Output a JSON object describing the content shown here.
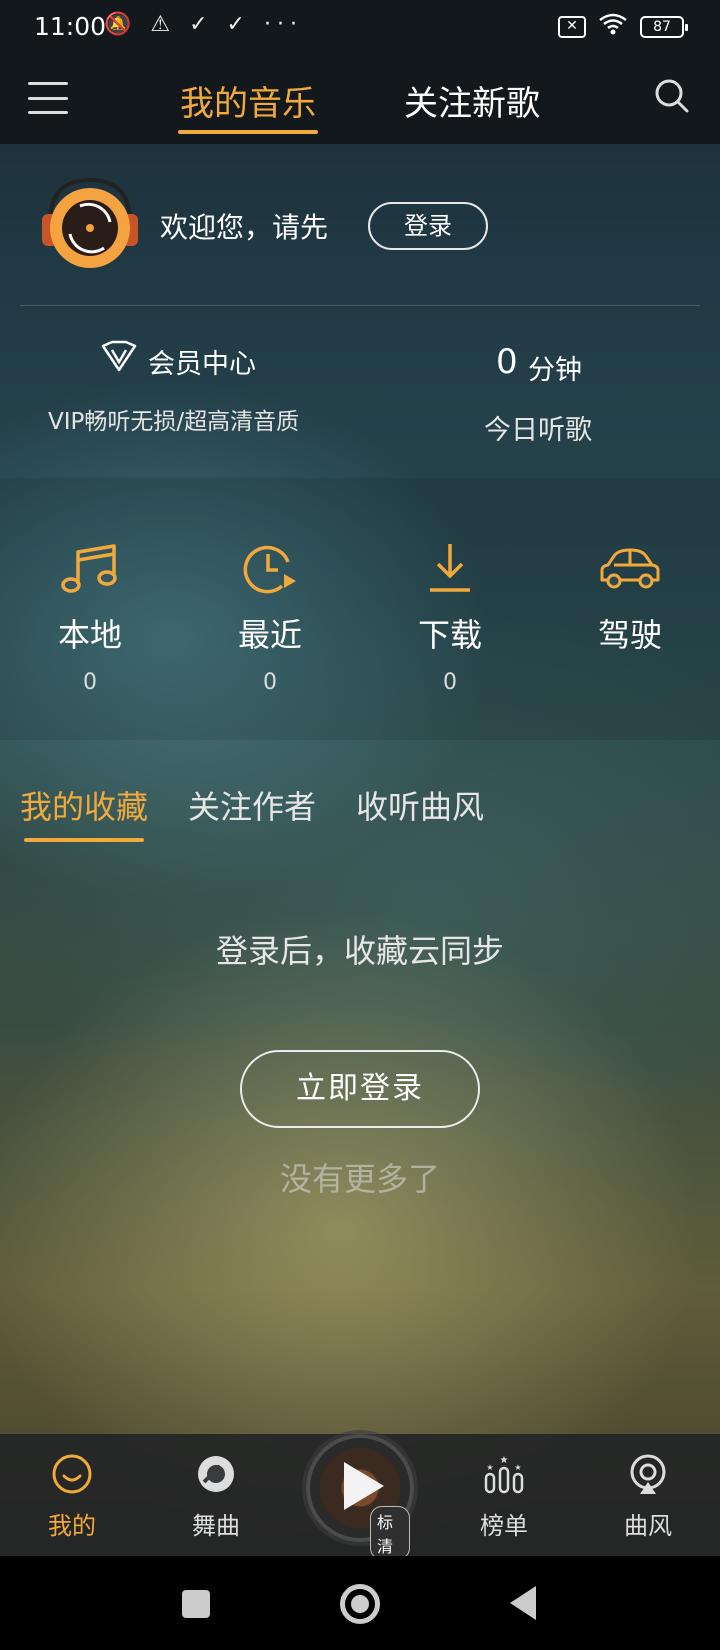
{
  "status_bar": {
    "time": "11:00",
    "left_icons": "🔕 ⚠ ✓ ✓ ···",
    "battery": "87"
  },
  "top_nav": {
    "tabs": [
      {
        "label": "我的音乐",
        "active": true
      },
      {
        "label": "关注新歌",
        "active": false
      }
    ]
  },
  "profile": {
    "welcome": "欢迎您，请先",
    "login_label": "登录"
  },
  "vip": {
    "title": "会员中心",
    "subtitle": "VIP畅听无损/超高清音质"
  },
  "today": {
    "minutes": "0",
    "unit": "分钟",
    "label": "今日听歌"
  },
  "quick_actions": [
    {
      "label": "本地",
      "count": "0",
      "icon": "music-note-icon"
    },
    {
      "label": "最近",
      "count": "0",
      "icon": "recent-clock-icon"
    },
    {
      "label": "下载",
      "count": "0",
      "icon": "download-icon"
    },
    {
      "label": "驾驶",
      "count": "",
      "icon": "car-icon"
    }
  ],
  "sub_tabs": [
    {
      "label": "我的收藏",
      "active": true
    },
    {
      "label": "关注作者",
      "active": false
    },
    {
      "label": "收听曲风",
      "active": false
    }
  ],
  "empty_state": {
    "message": "登录后，收藏云同步",
    "button": "立即登录",
    "no_more": "没有更多了"
  },
  "bottom_nav": {
    "items": [
      {
        "label": "我的",
        "icon": "smile-icon",
        "active": true
      },
      {
        "label": "舞曲",
        "icon": "disc-icon",
        "active": false
      },
      {
        "label": "榜单",
        "icon": "ranking-icon",
        "active": false
      },
      {
        "label": "曲风",
        "icon": "broadcast-icon",
        "active": false
      }
    ],
    "player_quality": "标清"
  },
  "colors": {
    "accent": "#f2a93b",
    "top_bar": "#13181d"
  }
}
